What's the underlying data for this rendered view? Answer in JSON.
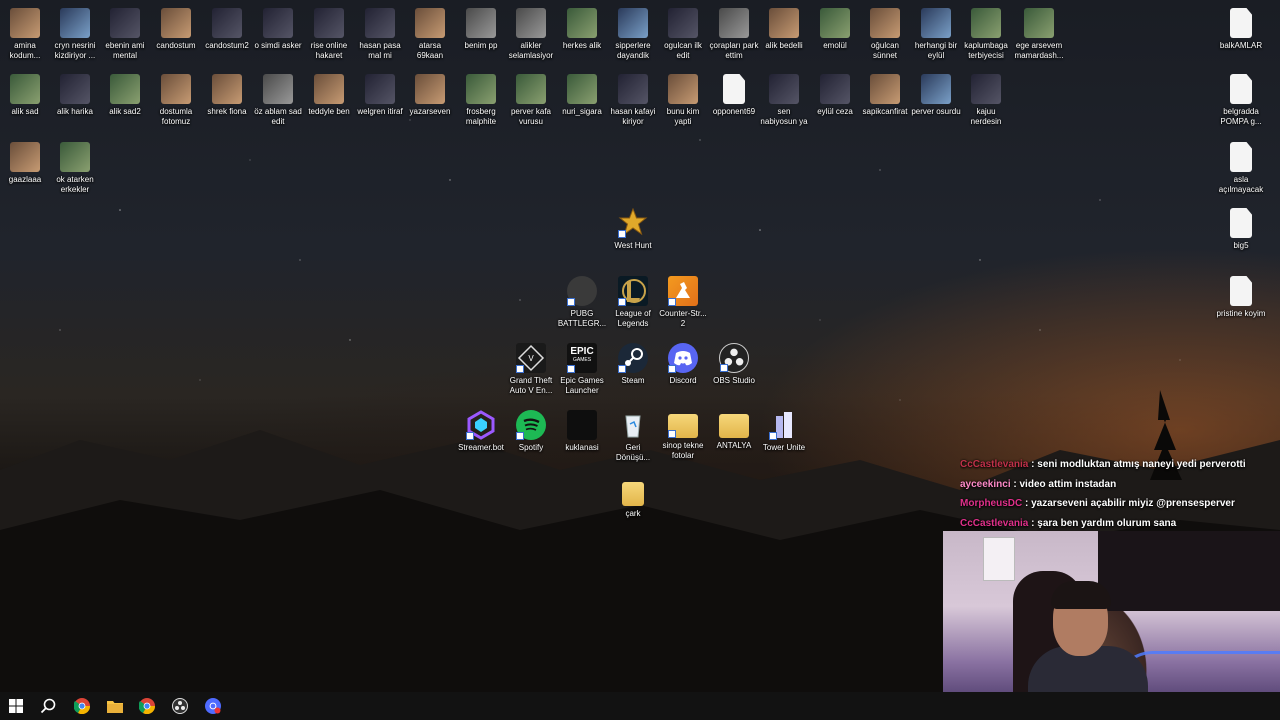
{
  "desktop": {
    "row1": [
      {
        "label": "amina kodum...",
        "kind": "img1"
      },
      {
        "label": "cryn nesrini kizdiriyor ...",
        "kind": "img5"
      },
      {
        "label": "ebenin ami mental",
        "kind": "img2"
      },
      {
        "label": "candostum",
        "kind": "img1"
      },
      {
        "label": "candostum2",
        "kind": "img2"
      },
      {
        "label": "o simdi asker",
        "kind": "img2"
      },
      {
        "label": "rise online hakaret",
        "kind": "img2"
      },
      {
        "label": "hasan pasa mal mi",
        "kind": "img2"
      },
      {
        "label": "atarsa 69kaan",
        "kind": "img1"
      },
      {
        "label": "benim pp",
        "kind": "img4"
      },
      {
        "label": "alikler selamlasiyor",
        "kind": "img4"
      },
      {
        "label": "herkes alik",
        "kind": "img3"
      },
      {
        "label": "sipperlere dayandik",
        "kind": "img5"
      },
      {
        "label": "ogulcan ilk edit",
        "kind": "img2"
      },
      {
        "label": "çorapları park ettim",
        "kind": "img4"
      },
      {
        "label": "alik bedelli",
        "kind": "img1"
      },
      {
        "label": "emolül",
        "kind": "img3"
      },
      {
        "label": "oğulcan sünnet",
        "kind": "img1"
      },
      {
        "label": "herhangi bir eylül",
        "kind": "img5"
      },
      {
        "label": "kaplumbaga terbiyecisi",
        "kind": "img3"
      },
      {
        "label": "ege arsevem mamardash...",
        "kind": "img3"
      }
    ],
    "row2": [
      {
        "label": "alik sad",
        "kind": "img3"
      },
      {
        "label": "alik harika",
        "kind": "img2"
      },
      {
        "label": "alik sad2",
        "kind": "img3"
      },
      {
        "label": "dostumla fotomuz",
        "kind": "img1"
      },
      {
        "label": "shrek fiona",
        "kind": "img1"
      },
      {
        "label": "öz ablam sad edit",
        "kind": "img4"
      },
      {
        "label": "teddyle ben",
        "kind": "img1"
      },
      {
        "label": "welgren itiraf",
        "kind": "img2"
      },
      {
        "label": "yazarseven",
        "kind": "img1"
      },
      {
        "label": "frosberg malphite",
        "kind": "img3"
      },
      {
        "label": "perver kafa vurusu",
        "kind": "img3"
      },
      {
        "label": "nuri_sigara",
        "kind": "img3"
      },
      {
        "label": "hasan kafayi kiriyor",
        "kind": "img2"
      },
      {
        "label": "bunu kim yapti",
        "kind": "img1"
      },
      {
        "label": "opponent69",
        "kind": "doc"
      },
      {
        "label": "sen nabiyosun ya",
        "kind": "img2"
      },
      {
        "label": "eylül ceza",
        "kind": "img2"
      },
      {
        "label": "sapikcanfirat",
        "kind": "img1"
      },
      {
        "label": "perver osurdu",
        "kind": "img5"
      },
      {
        "label": "kajuu nerdesin",
        "kind": "img2"
      }
    ],
    "row3": [
      {
        "label": "gaazlaaa",
        "kind": "img1"
      },
      {
        "label": "ok atarken erkekler",
        "kind": "img3"
      }
    ],
    "right_column": [
      {
        "label": "balkAMLAR",
        "kind": "doc"
      },
      {
        "label": "belgradda POMPA g...",
        "kind": "doc"
      },
      {
        "label": "asla açılmayacak",
        "kind": "doc"
      },
      {
        "label": "big5",
        "kind": "doc"
      },
      {
        "label": "pristine koyim",
        "kind": "doc"
      }
    ],
    "apps": {
      "west_hunt": "West Hunt",
      "pubg": "PUBG BATTLEGR...",
      "league": "League of Legends",
      "counter_strike": "Counter-Str... 2",
      "gta": "Grand Theft Auto V En...",
      "epic": "Epic Games Launcher",
      "steam": "Steam",
      "discord": "Discord",
      "obs": "OBS Studio",
      "streamerbot": "Streamer.bot",
      "spotify": "Spotify",
      "kuklanasi": "kuklanasi",
      "recycle_bin": "Geri Dönüşü...",
      "sinop": "sinop tekne fotolar",
      "antalya": "ANTALYA",
      "tower_unite": "Tower Unite",
      "cark": "çark",
      "epic_logo_line1": "EPIC",
      "epic_logo_line2": "GAMES"
    }
  },
  "chat": [
    {
      "user": "CcCastlevania",
      "message": "seni modluktan atmış naneyi yedi perverotti",
      "color": "#c0314a"
    },
    {
      "user": "ayceekinci",
      "message": "video attim instadan",
      "color": "#ff8ac8"
    },
    {
      "user": "MorpheusDC",
      "message": "yazarseveni açabilir miyiz @prensesperver",
      "color": "#e0308a"
    },
    {
      "user": "CcCastlevania",
      "message": "şara ben yardım olurum sana",
      "color": "#e0308a"
    }
  ],
  "chat_separator": " : ",
  "colors": {
    "taskbar": "#121212",
    "chrome_red": "#db4437",
    "chrome_yellow": "#f4b400",
    "chrome_green": "#0f9d58",
    "chrome_blue": "#4285f4",
    "discord": "#5865f2",
    "spotify": "#1db954",
    "steam": "#1b2838"
  }
}
